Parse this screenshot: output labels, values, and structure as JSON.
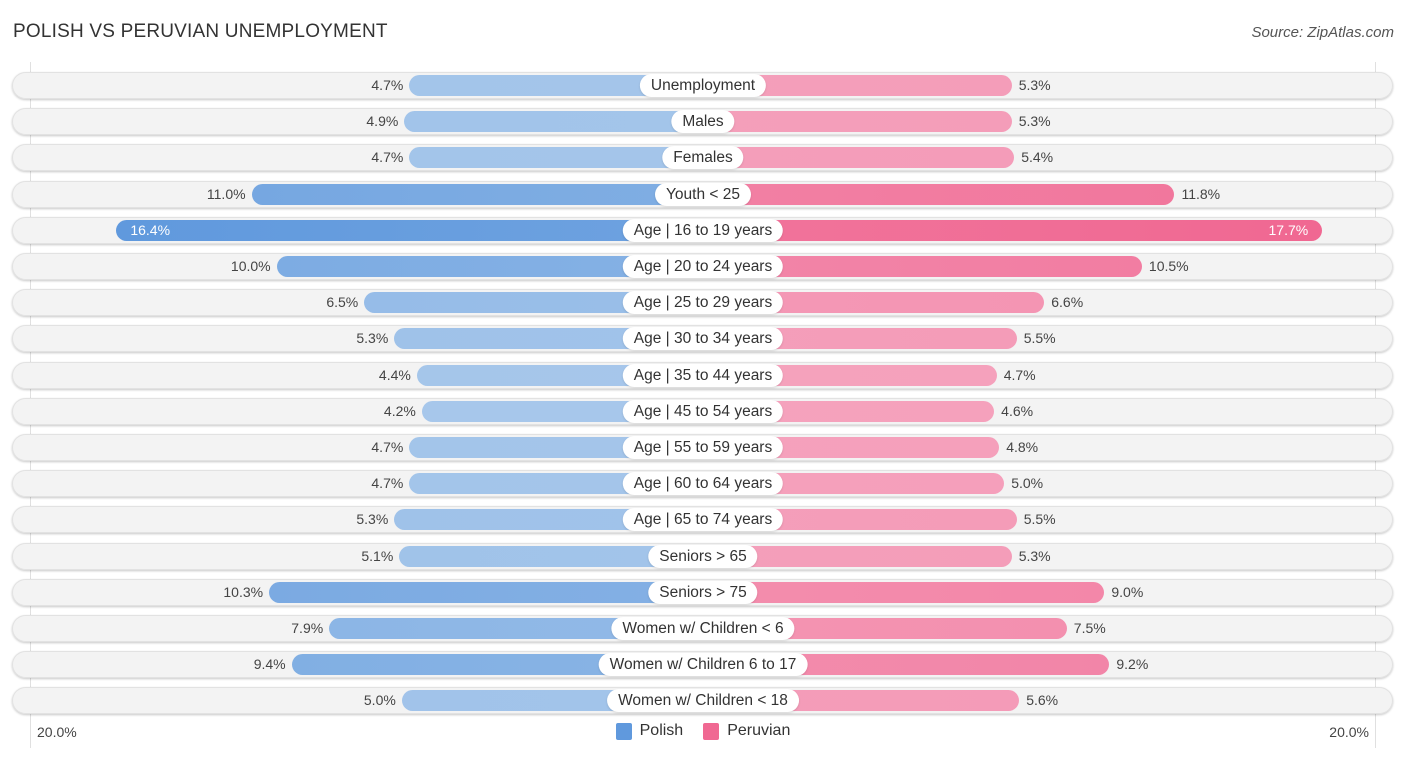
{
  "header": {
    "title": "POLISH VS PERUVIAN UNEMPLOYMENT",
    "source": "Source: ZipAtlas.com"
  },
  "chart_data": {
    "type": "bar",
    "orientation": "horizontal-diverging",
    "title": "POLISH VS PERUVIAN UNEMPLOYMENT",
    "xlim": [
      -20,
      20
    ],
    "axis_labels": {
      "left": "20.0%",
      "right": "20.0%"
    },
    "legend": {
      "placement": "bottom-center"
    },
    "colors": {
      "Polish": "#6099dd",
      "Peruvian": "#f06892",
      "Polish_light": "#a8c8eb",
      "Peruvian_light": "#f5a5bf"
    },
    "categories": [
      "Unemployment",
      "Males",
      "Females",
      "Youth < 25",
      "Age | 16 to 19 years",
      "Age | 20 to 24 years",
      "Age | 25 to 29 years",
      "Age | 30 to 34 years",
      "Age | 35 to 44 years",
      "Age | 45 to 54 years",
      "Age | 55 to 59 years",
      "Age | 60 to 64 years",
      "Age | 65 to 74 years",
      "Seniors > 65",
      "Seniors > 75",
      "Women w/ Children < 6",
      "Women w/ Children 6 to 17",
      "Women w/ Children < 18"
    ],
    "series": [
      {
        "name": "Polish",
        "values": [
          4.7,
          4.9,
          4.7,
          11.0,
          16.4,
          10.0,
          6.5,
          5.3,
          4.4,
          4.2,
          4.7,
          4.7,
          5.3,
          5.1,
          10.3,
          7.9,
          9.4,
          5.0
        ],
        "labels": [
          "4.7%",
          "4.9%",
          "4.7%",
          "11.0%",
          "16.4%",
          "10.0%",
          "6.5%",
          "5.3%",
          "4.4%",
          "4.2%",
          "4.7%",
          "4.7%",
          "5.3%",
          "5.1%",
          "10.3%",
          "7.9%",
          "9.4%",
          "5.0%"
        ]
      },
      {
        "name": "Peruvian",
        "values": [
          5.3,
          5.3,
          5.4,
          11.8,
          17.7,
          10.5,
          6.6,
          5.5,
          4.7,
          4.6,
          4.8,
          5.0,
          5.5,
          5.3,
          9.0,
          7.5,
          9.2,
          5.6
        ],
        "labels": [
          "5.3%",
          "5.3%",
          "5.4%",
          "11.8%",
          "17.7%",
          "10.5%",
          "6.6%",
          "5.5%",
          "4.7%",
          "4.6%",
          "4.8%",
          "5.0%",
          "5.5%",
          "5.3%",
          "9.0%",
          "7.5%",
          "9.2%",
          "5.6%"
        ]
      }
    ],
    "highlighted_index": 4
  }
}
